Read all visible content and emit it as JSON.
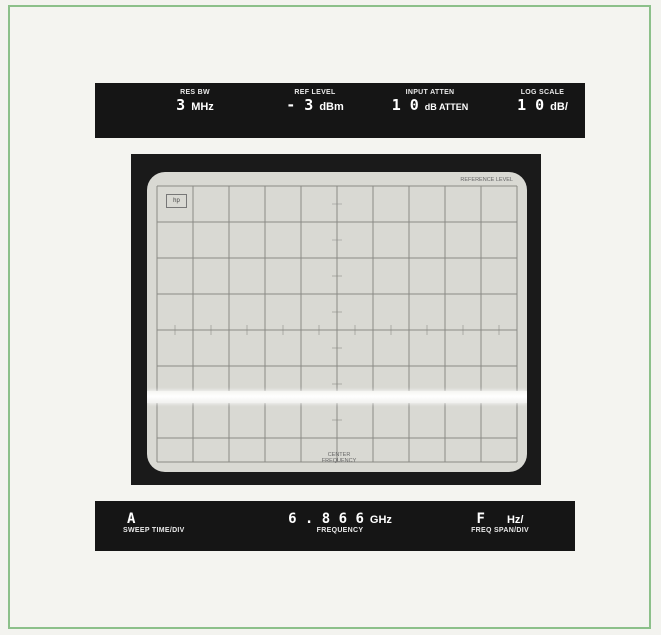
{
  "top_readout": {
    "res_bw": {
      "label": "RES BW",
      "value": "3",
      "unit": "MHz"
    },
    "ref_level": {
      "label": "REF LEVEL",
      "value": "- 3",
      "unit": "dBm"
    },
    "input_atten": {
      "label": "INPUT ATTEN",
      "value": "1 0",
      "unit": "dB ATTEN"
    },
    "log_scale": {
      "label": "LOG SCALE",
      "value": "1 0",
      "unit": "dB/"
    }
  },
  "screen": {
    "reference_level_label": "REFERENCE LEVEL",
    "center_frequency_label_1": "CENTER",
    "center_frequency_label_2": "FREQUENCY",
    "logo_text": "hp"
  },
  "bottom_readout": {
    "sweep_time": {
      "label": "SWEEP TIME/DIV",
      "value": "A"
    },
    "frequency": {
      "label": "FREQUENCY",
      "value": "6 . 8 6 6",
      "unit": "GHz"
    },
    "freq_span": {
      "label": "FREQ SPAN/DIV",
      "value": "F",
      "unit": "Hz/"
    }
  }
}
